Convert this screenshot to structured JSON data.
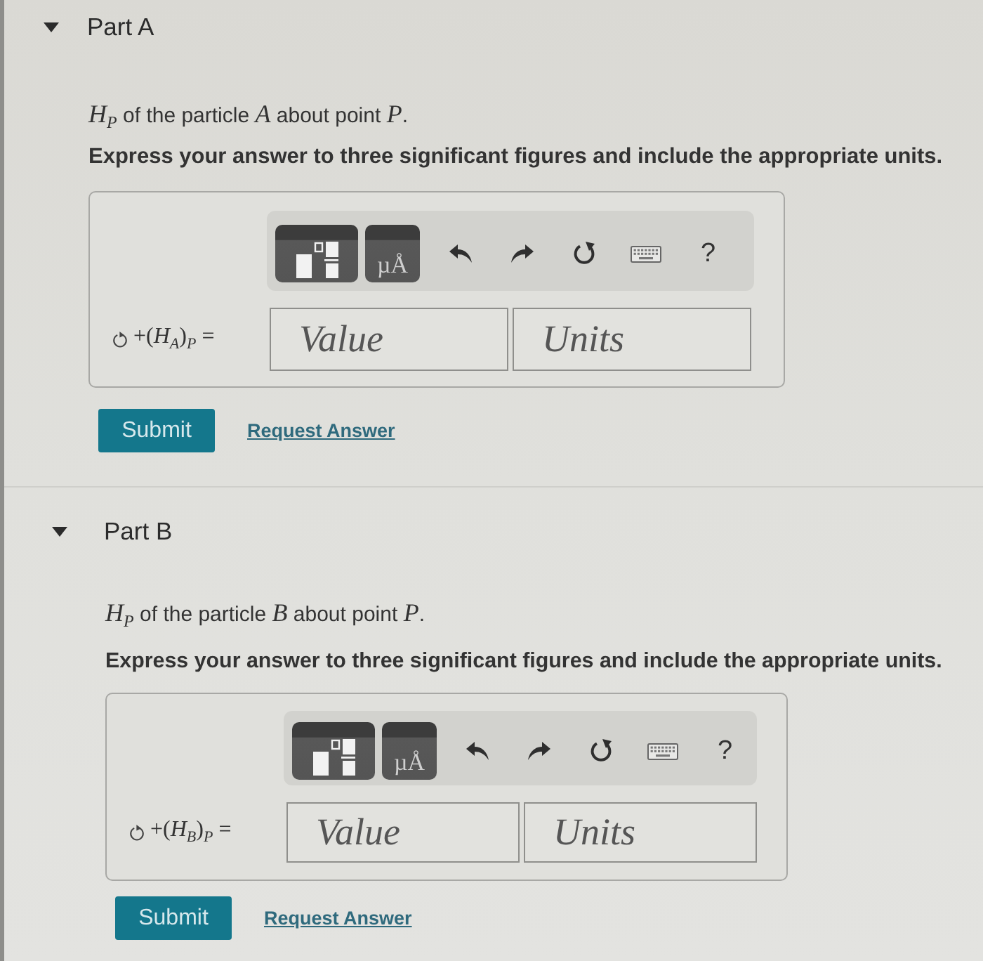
{
  "parts": [
    {
      "title": "Part A",
      "expanded": true,
      "question": "*H*$_{P}$ of the particle *A* about point *P*.",
      "instruction": "Express your answer to three significant figures and include the appropriate units.",
      "toolbar": [
        {
          "kind": "templates"
        },
        {
          "kind": "units",
          "label": "µÅ"
        },
        {
          "kind": "undo"
        },
        {
          "kind": "redo"
        },
        {
          "kind": "reset"
        },
        {
          "kind": "keyboard"
        },
        {
          "kind": "help",
          "label": "?"
        }
      ],
      "answer_label": "+(*H*$_{A}$)$_{P}$ =",
      "value_field": {
        "placeholder": "Value"
      },
      "units_field": {
        "placeholder": "Units"
      },
      "submit": "Submit",
      "request_answer": "Request Answer"
    },
    {
      "title": "Part B",
      "expanded": true,
      "question": "*H*$_{P}$ of the particle *B* about point *P*.",
      "instruction": "Express your answer to three significant figures and include the appropriate units.",
      "toolbar": [
        {
          "kind": "templates"
        },
        {
          "kind": "units",
          "label": "µÅ"
        },
        {
          "kind": "undo"
        },
        {
          "kind": "redo"
        },
        {
          "kind": "reset"
        },
        {
          "kind": "keyboard"
        },
        {
          "kind": "help",
          "label": "?"
        }
      ],
      "answer_label": "+(*H*$_{B}$)$_{P}$ =",
      "value_field": {
        "placeholder": "Value"
      },
      "units_field": {
        "placeholder": "Units"
      },
      "submit": "Submit",
      "request_answer": "Request Answer"
    }
  ]
}
